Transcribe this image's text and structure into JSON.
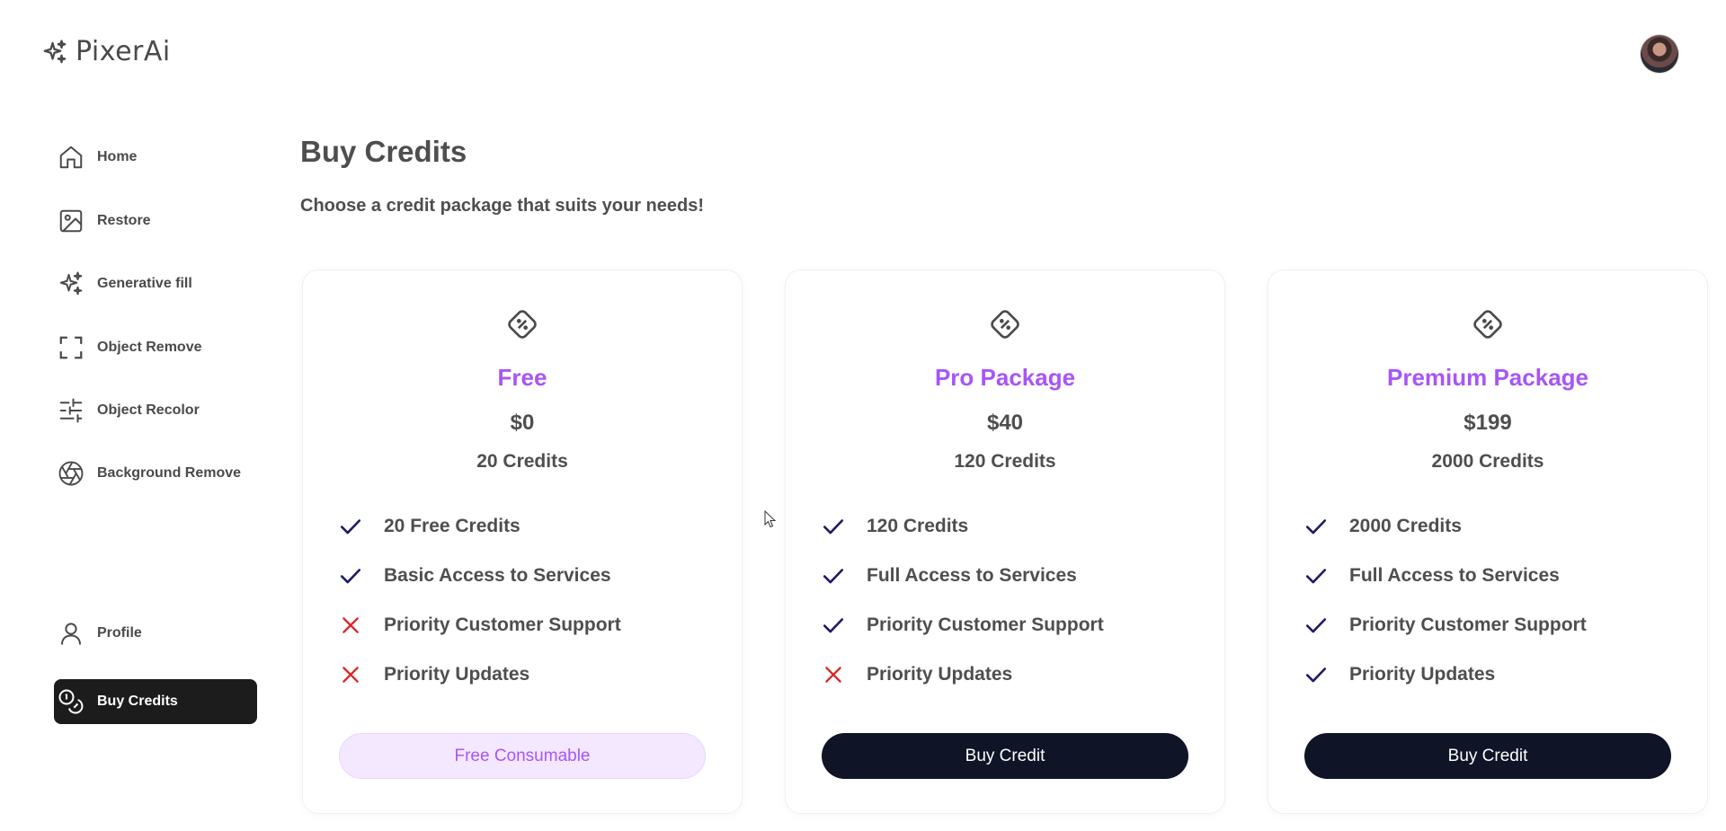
{
  "header": {
    "logo_text": "PixerAi",
    "logo_icon": "sparkles-icon",
    "avatar": "user-avatar"
  },
  "sidebar": {
    "items": [
      {
        "label": "Home",
        "icon": "home-icon"
      },
      {
        "label": "Restore",
        "icon": "image-icon"
      },
      {
        "label": "Generative fill",
        "icon": "sparkles-icon"
      },
      {
        "label": "Object Remove",
        "icon": "scan-frame-icon"
      },
      {
        "label": "Object Recolor",
        "icon": "sliders-icon"
      },
      {
        "label": "Background Remove",
        "icon": "aperture-icon"
      }
    ],
    "bottom_items": [
      {
        "label": "Profile",
        "icon": "user-icon",
        "active": false
      },
      {
        "label": "Buy Credits",
        "icon": "coins-icon",
        "active": true
      }
    ]
  },
  "main": {
    "title": "Buy Credits",
    "subtitle": "Choose a credit package that suits your needs!",
    "plans": [
      {
        "name": "Free",
        "price": "$0",
        "credits": "20 Credits",
        "icon": "discount-tag-icon",
        "features": [
          {
            "text": "20 Free Credits",
            "included": true
          },
          {
            "text": "Basic Access to Services",
            "included": true
          },
          {
            "text": "Priority Customer Support",
            "included": false
          },
          {
            "text": "Priority Updates",
            "included": false
          }
        ],
        "button": "Free Consumable",
        "button_style": "light"
      },
      {
        "name": "Pro Package",
        "price": "$40",
        "credits": "120 Credits",
        "icon": "discount-tag-icon",
        "features": [
          {
            "text": "120 Credits",
            "included": true
          },
          {
            "text": "Full Access to Services",
            "included": true
          },
          {
            "text": "Priority Customer Support",
            "included": true
          },
          {
            "text": "Priority Updates",
            "included": false
          }
        ],
        "button": "Buy Credit",
        "button_style": "dark"
      },
      {
        "name": "Premium Package",
        "price": "$199",
        "credits": "2000 Credits",
        "icon": "discount-tag-icon",
        "features": [
          {
            "text": "2000 Credits",
            "included": true
          },
          {
            "text": "Full Access to Services",
            "included": true
          },
          {
            "text": "Priority Customer Support",
            "included": true
          },
          {
            "text": "Priority Updates",
            "included": true
          }
        ],
        "button": "Buy Credit",
        "button_style": "dark"
      }
    ]
  },
  "colors": {
    "accent": "#a855f7",
    "check": "#1e1b6b",
    "cross": "#dc2626",
    "dark_button": "#0f1426",
    "light_button": "#f3e8ff",
    "active_nav": "#1c1c1c"
  }
}
